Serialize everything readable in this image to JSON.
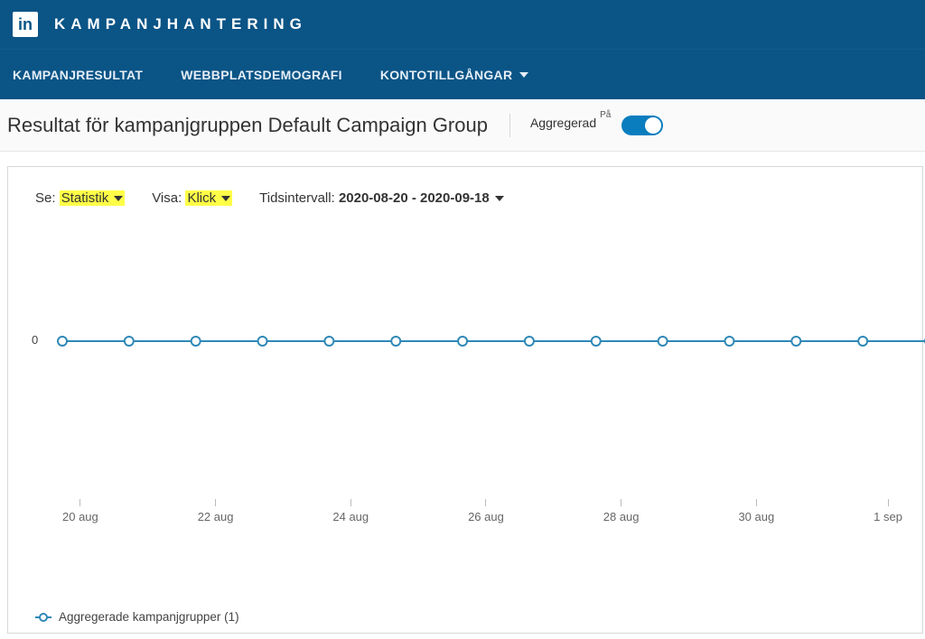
{
  "brand": {
    "logo_text": "in",
    "app_title": "KAMPANJHANTERING"
  },
  "nav": {
    "items": [
      {
        "label": "KAMPANJRESULTAT",
        "has_caret": false
      },
      {
        "label": "WEBBPLATSDEMOGRAFI",
        "has_caret": false
      },
      {
        "label": "KONTOTILLGÅNGAR",
        "has_caret": true
      }
    ]
  },
  "subheader": {
    "title": "Resultat för kampanjgruppen Default Campaign Group",
    "aggregated_label": "Aggregerad",
    "aggregated_sup": "På",
    "aggregated_on": true
  },
  "controls": {
    "see_label": "Se:",
    "see_value": "Statistik",
    "show_label": "Visa:",
    "show_value": "Klick",
    "interval_label": "Tidsintervall:",
    "interval_value": "2020-08-20 - 2020-09-18"
  },
  "legend": {
    "label": "Aggregerade kampanjgrupper (1)"
  },
  "chart_data": {
    "type": "line",
    "title": "",
    "xlabel": "",
    "ylabel": "",
    "ylim": [
      0,
      0
    ],
    "y_ticks": [
      0
    ],
    "x_ticks": [
      "20 aug",
      "22 aug",
      "24 aug",
      "26 aug",
      "28 aug",
      "30 aug",
      "1 sep"
    ],
    "categories": [
      "20 aug",
      "21 aug",
      "22 aug",
      "23 aug",
      "24 aug",
      "25 aug",
      "26 aug",
      "27 aug",
      "28 aug",
      "29 aug",
      "30 aug",
      "31 aug",
      "1 sep",
      "2 sep"
    ],
    "series": [
      {
        "name": "Aggregerade kampanjgrupper (1)",
        "values": [
          0,
          0,
          0,
          0,
          0,
          0,
          0,
          0,
          0,
          0,
          0,
          0,
          0,
          0
        ]
      }
    ],
    "colors": {
      "line": "#2f88b7"
    }
  }
}
